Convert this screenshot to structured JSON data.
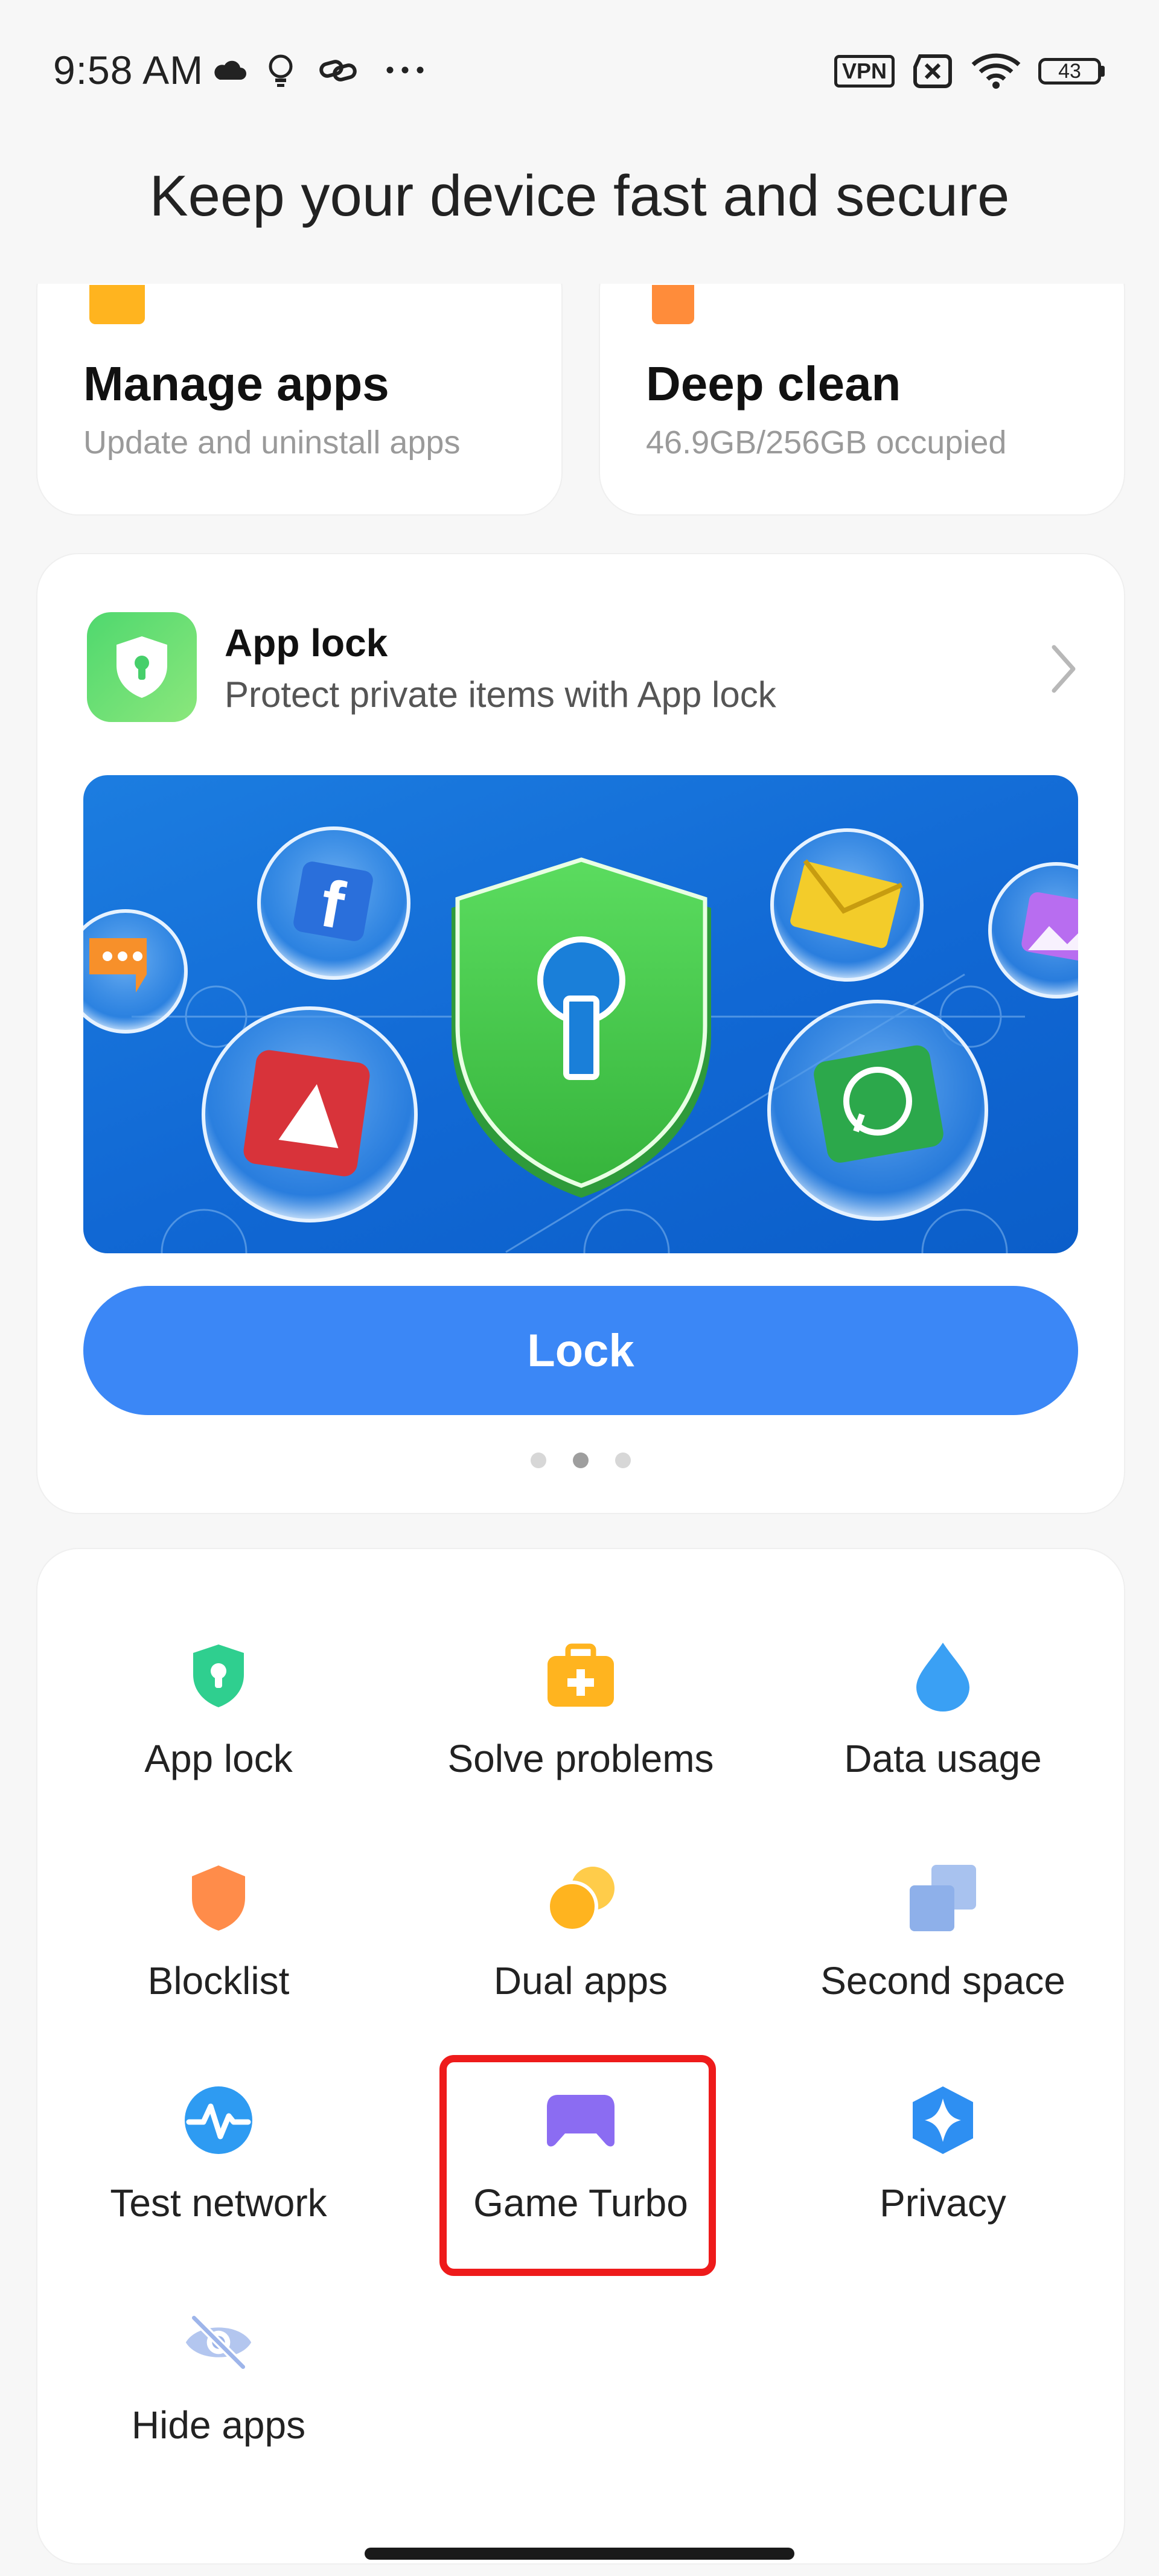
{
  "status_bar": {
    "time": "9:58 AM",
    "left_icons": [
      "cloud-icon",
      "lightbulb-icon",
      "link-icon",
      "more-dots-icon"
    ],
    "vpn_label": "VPN",
    "battery_level": "43",
    "right_icons": [
      "vpn-icon",
      "no-sim-icon",
      "wifi-icon",
      "battery-icon"
    ]
  },
  "header": {
    "title": "Keep your device fast and secure"
  },
  "top_cards": [
    {
      "title": "Manage apps",
      "subtitle": "Update and uninstall apps",
      "accent": "#ffb41f"
    },
    {
      "title": "Deep clean",
      "subtitle": "46.9GB/256GB occupied",
      "accent": "#ff8c3a"
    }
  ],
  "app_lock_card": {
    "title": "App lock",
    "subtitle": "Protect private items with App lock",
    "button_label": "Lock",
    "carousel_pages": 3,
    "carousel_active_index": 1,
    "banner_icons": [
      "messages-bubble-icon",
      "facebook-bubble-icon",
      "youtube-bubble-icon",
      "shield-lock-icon",
      "mail-bubble-icon",
      "whatsapp-bubble-icon",
      "gallery-bubble-icon"
    ]
  },
  "tools": [
    {
      "label": "App lock",
      "icon": "shield-keyhole-icon",
      "color": "#2fcf8f"
    },
    {
      "label": "Solve problems",
      "icon": "first-aid-kit-icon",
      "color": "#ffb41f"
    },
    {
      "label": "Data usage",
      "icon": "water-drop-icon",
      "color": "#3aa0f4"
    },
    {
      "label": "Blocklist",
      "icon": "shield-icon",
      "color": "#ff8c4a"
    },
    {
      "label": "Dual apps",
      "icon": "dual-circles-icon",
      "color": "#ffb41f"
    },
    {
      "label": "Second space",
      "icon": "stacked-squares-icon",
      "color": "#8eb0ea"
    },
    {
      "label": "Test network",
      "icon": "heartbeat-icon",
      "color": "#2e9bf2"
    },
    {
      "label": "Game Turbo",
      "icon": "gamepad-icon",
      "color": "#8b6cf2"
    },
    {
      "label": "Privacy",
      "icon": "privacy-diamond-icon",
      "color": "#2e8ff2"
    },
    {
      "label": "Hide apps",
      "icon": "eye-slash-icon",
      "color": "#9eb5ea"
    }
  ],
  "highlight": {
    "target": "Game Turbo",
    "color": "#ee1b1b"
  }
}
